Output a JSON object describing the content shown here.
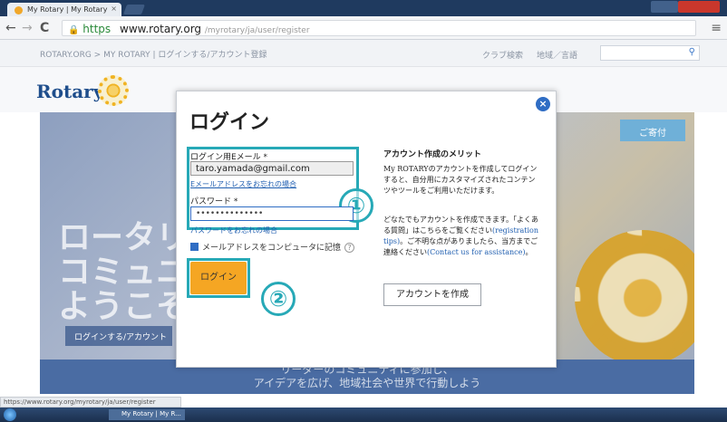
{
  "browser": {
    "tab_title": "My Rotary | My Rotary",
    "tab_close": "×",
    "url_https": "https",
    "url_domain": "www.rotary.org",
    "url_path": "/myrotary/ja/user/register",
    "back": "←",
    "forward": "→",
    "reload": "C",
    "menu": "≡"
  },
  "site": {
    "breadcrumb": "ROTARY.ORG > MY ROTARY | ログインする/アカウント登録",
    "club_search": "クラブ検索",
    "region": "地域／言語",
    "logo_text": "Rotary",
    "donate": "ご寄付",
    "hero_text": "ロータリ\nコミュニ\nようこそ",
    "hero_cta": "ログインする/アカウント",
    "hero_bottom_line1": "リーダーのコミュニティに参加し、",
    "hero_bottom_line2": "アイデアを広げ、地域社会や世界で行動しよう"
  },
  "modal": {
    "title": "ログイン",
    "close": "×",
    "step1": "①",
    "step2": "②",
    "email_label": "ログイン用Eメール *",
    "email_value": "taro.yamada@gmail.com",
    "forgot_email": "Eメールアドレスをお忘れの場合",
    "password_label": "パスワード *",
    "password_value": "••••••••••••••",
    "forgot_password": "パスワードをお忘れの場合",
    "remember_label": "メールアドレスをコンピュータに記憶",
    "help": "?",
    "login_button": "ログイン",
    "benefits_title": "アカウント作成のメリット",
    "benefits_p1": "My ROTARYのアカウントを作成してログインすると、自分用にカスタマイズされたコンテンツやツールをご利用いただけます。",
    "benefits_p2_a": "どなたでもアカウントを作成できます。「よくある質問」はこちらをご覧ください",
    "benefits_link1": "(registration tips)",
    "benefits_p2_b": "。ご不明な点がありましたら、当方までご連絡ください",
    "benefits_link2": "(Contact us for assistance)",
    "benefits_p2_c": "。",
    "create_account": "アカウントを作成"
  },
  "status": {
    "url": "https://www.rotary.org/myrotary/ja/user/register",
    "task_item": "My Rotary | My R..."
  }
}
